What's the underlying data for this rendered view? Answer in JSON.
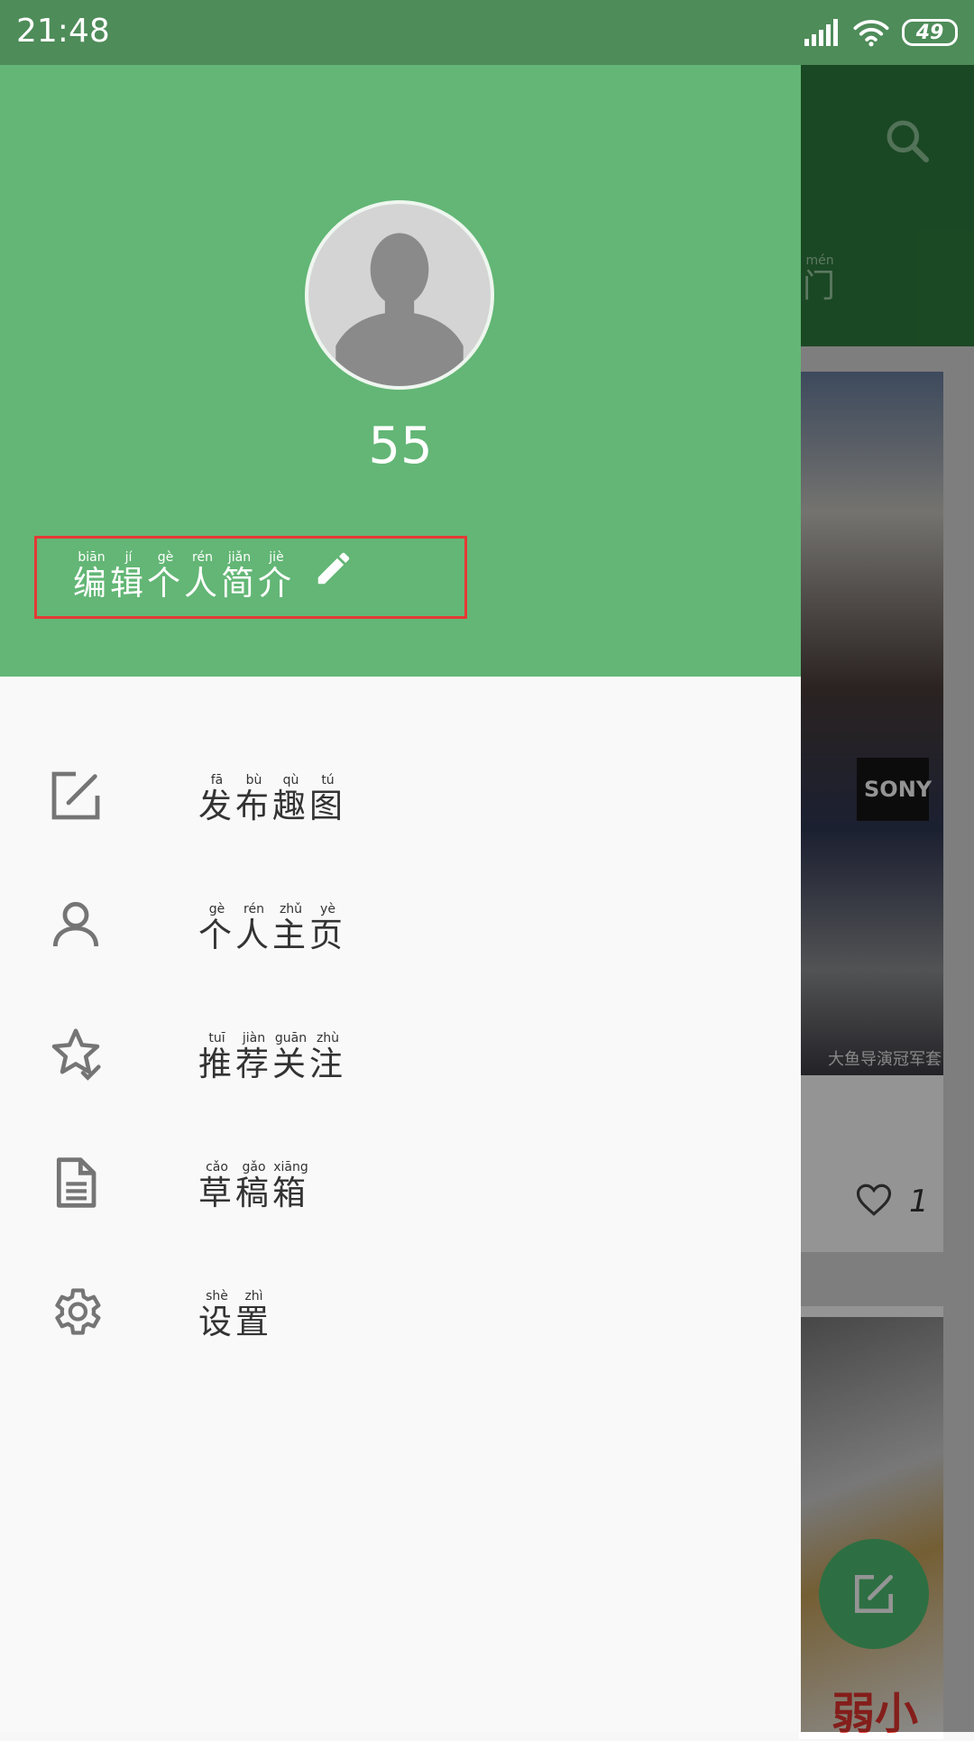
{
  "status_bar": {
    "time": "21:48",
    "battery": "49"
  },
  "drawer": {
    "user_name": "55",
    "edit_bio": {
      "chars": [
        {
          "hanzi": "编",
          "pinyin": "biān"
        },
        {
          "hanzi": "辑",
          "pinyin": "jí"
        },
        {
          "hanzi": "个",
          "pinyin": "gè"
        },
        {
          "hanzi": "人",
          "pinyin": "rén"
        },
        {
          "hanzi": "简",
          "pinyin": "jiǎn"
        },
        {
          "hanzi": "介",
          "pinyin": "jiè"
        }
      ],
      "icon": "pencil-icon"
    },
    "menu": [
      {
        "icon": "compose-icon",
        "chars": [
          {
            "hanzi": "发",
            "pinyin": "fā"
          },
          {
            "hanzi": "布",
            "pinyin": "bù"
          },
          {
            "hanzi": "趣",
            "pinyin": "qù"
          },
          {
            "hanzi": "图",
            "pinyin": "tú"
          }
        ]
      },
      {
        "icon": "person-icon",
        "chars": [
          {
            "hanzi": "个",
            "pinyin": "gè"
          },
          {
            "hanzi": "人",
            "pinyin": "rén"
          },
          {
            "hanzi": "主",
            "pinyin": "zhǔ"
          },
          {
            "hanzi": "页",
            "pinyin": "yè"
          }
        ]
      },
      {
        "icon": "star-check-icon",
        "chars": [
          {
            "hanzi": "推",
            "pinyin": "tuī"
          },
          {
            "hanzi": "荐",
            "pinyin": "jiàn"
          },
          {
            "hanzi": "关",
            "pinyin": "guān"
          },
          {
            "hanzi": "注",
            "pinyin": "zhù"
          }
        ]
      },
      {
        "icon": "document-icon",
        "chars": [
          {
            "hanzi": "草",
            "pinyin": "cǎo"
          },
          {
            "hanzi": "稿",
            "pinyin": "gǎo"
          },
          {
            "hanzi": "箱",
            "pinyin": "xiāng"
          }
        ]
      },
      {
        "icon": "gear-icon",
        "chars": [
          {
            "hanzi": "设",
            "pinyin": "shè"
          },
          {
            "hanzi": "置",
            "pinyin": "zhì"
          }
        ]
      }
    ]
  },
  "background_app": {
    "tab_label": {
      "hanzi": "门",
      "pinyin": "mén"
    },
    "watermark": "大鱼导演冠军套",
    "sign_text": "SONY",
    "like_count": "1",
    "image_text": "弱小"
  },
  "colors": {
    "header_green": "#63b675",
    "status_green": "#4e8c59",
    "highlight_red": "#e53935",
    "icon_gray": "#757575"
  }
}
